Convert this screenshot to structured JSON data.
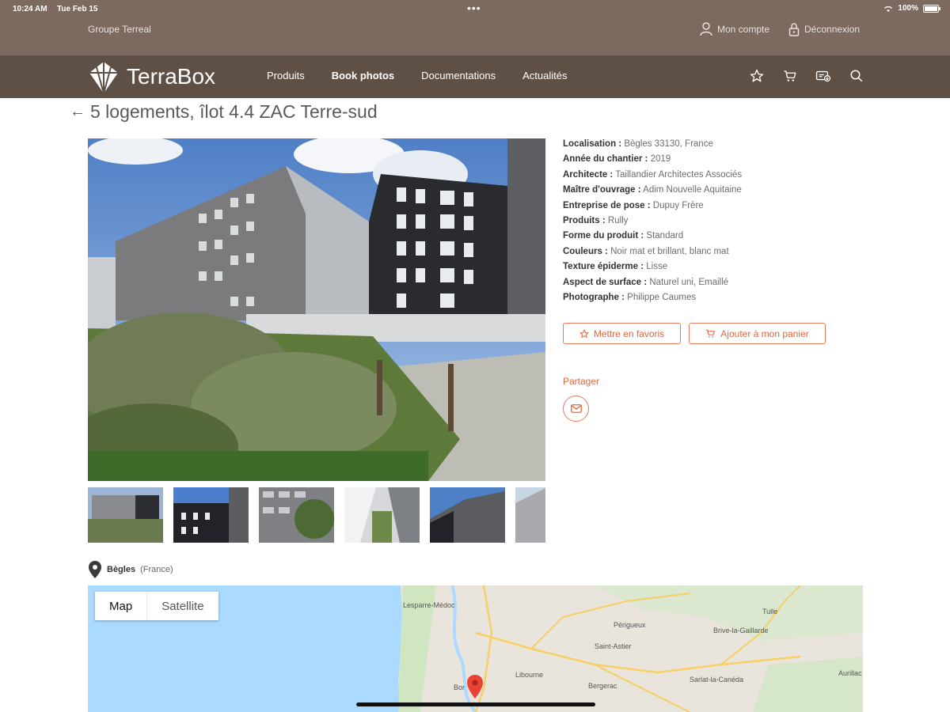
{
  "status_bar": {
    "time": "10:24 AM",
    "date": "Tue Feb 15",
    "battery": "100%"
  },
  "top_bar": {
    "group": "Groupe Terreal",
    "account": "Mon compte",
    "logout": "Déconnexion"
  },
  "nav": {
    "logo_text_light": "Terra",
    "logo_text_bold": "Box",
    "items": [
      "Produits",
      "Book photos",
      "Documentations",
      "Actualités"
    ],
    "active": "Book photos",
    "icons": [
      "star-icon",
      "cart-icon",
      "download-icon",
      "search-icon"
    ]
  },
  "page": {
    "title": "5 logements, îlot 4.4 ZAC Terre-sud"
  },
  "details": [
    {
      "label": "Localisation :",
      "value": "Bègles 33130, France"
    },
    {
      "label": "Année du chantier :",
      "value": "2019"
    },
    {
      "label": "Architecte :",
      "value": "Taillandier Architectes Associés"
    },
    {
      "label": "Maître d'ouvrage :",
      "value": "Adim Nouvelle Aquitaine"
    },
    {
      "label": "Entreprise de pose :",
      "value": "Dupuy Frère"
    },
    {
      "label": "Produits :",
      "value": "Rully"
    },
    {
      "label": "Forme du produit :",
      "value": "Standard"
    },
    {
      "label": "Couleurs :",
      "value": "Noir mat et brillant, blanc mat"
    },
    {
      "label": "Texture épiderme :",
      "value": "Lisse"
    },
    {
      "label": "Aspect de surface :",
      "value": "Naturel uni, Emaillé"
    },
    {
      "label": "Photographe :",
      "value": "Philippe Caumes"
    }
  ],
  "actions": {
    "favorite": "Mettre en favoris",
    "cart": "Ajouter à mon panier"
  },
  "share": {
    "label": "Partager"
  },
  "location": {
    "city": "Bègles",
    "country": "(France)"
  },
  "map": {
    "toggle_map": "Map",
    "toggle_satellite": "Satellite",
    "labels": [
      "Lesparre-Médoc",
      "Périgueux",
      "Tulle",
      "Brive-la-Gaillarde",
      "Saint-Astier",
      "Libourne",
      "Bergerac",
      "Sarlat-la-Canéda",
      "Bor",
      "Aurillac"
    ]
  },
  "colors": {
    "brand_brown": "#7b6a5d",
    "nav_brown": "#5f5046",
    "accent": "#e0673f"
  }
}
